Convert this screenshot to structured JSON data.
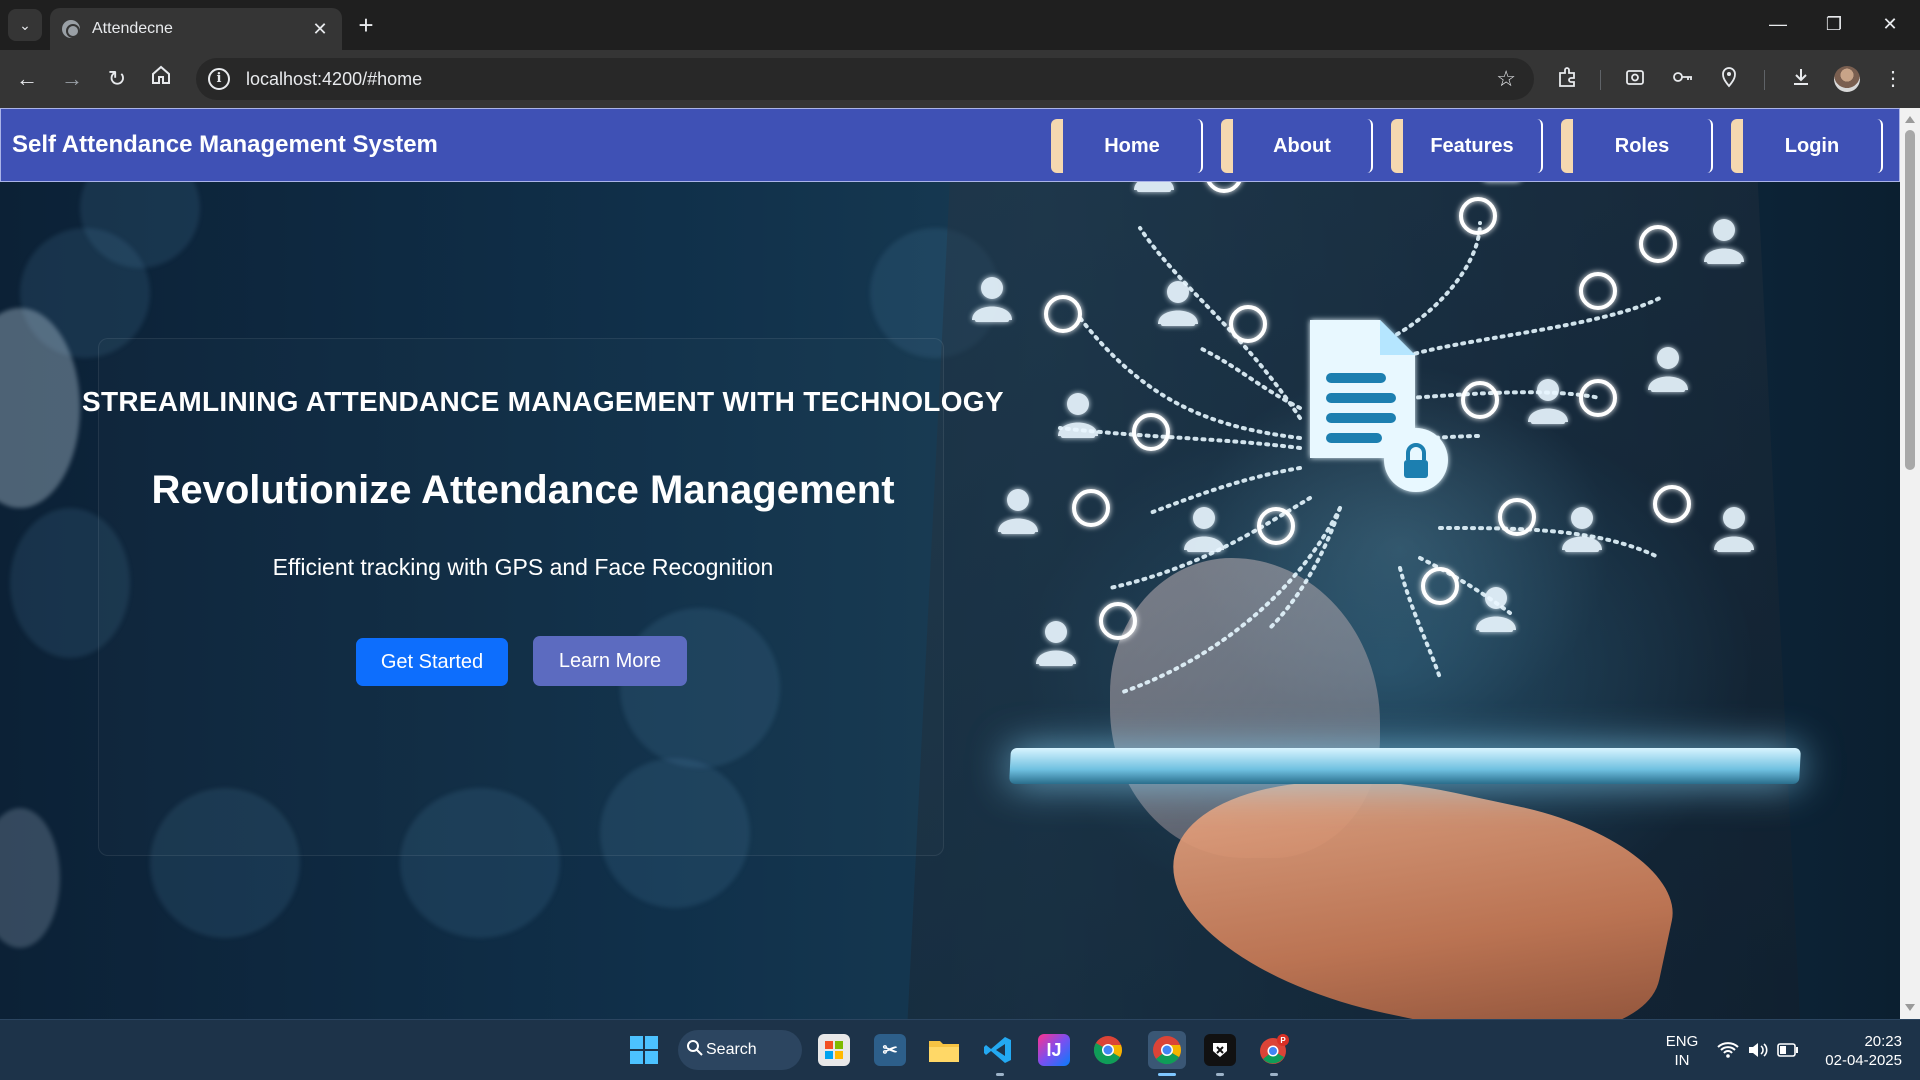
{
  "browser": {
    "tab_title": "Attendecne",
    "tab_close": "✕",
    "new_tab": "+",
    "url": "localhost:4200/#home",
    "window_controls": {
      "minimize": "—",
      "restore": "❐",
      "close": "✕"
    }
  },
  "navbar": {
    "brand": "Self Attendance Management System",
    "items": [
      {
        "label": "Home"
      },
      {
        "label": "About"
      },
      {
        "label": "Features"
      },
      {
        "label": "Roles"
      },
      {
        "label": "Login"
      }
    ],
    "accent_color": "#3f51b5"
  },
  "hero": {
    "tagline": "STREAMLINING ATTENDANCE MANAGEMENT WITH TECHNOLOGY",
    "headline": "Revolutionize Attendance Management",
    "subline": "Efficient tracking with GPS and Face Recognition",
    "primary_button": "Get Started",
    "secondary_button": "Learn More",
    "primary_color": "#0d6efd",
    "secondary_color": "#5c6bc0"
  },
  "taskbar": {
    "search_label": "Search",
    "language": "ENG",
    "region": "IN",
    "time": "20:23",
    "date": "02-04-2025",
    "apps": [
      "windows-start",
      "microsoft-store",
      "snipping-tool",
      "file-explorer",
      "vscode",
      "intellij",
      "chrome",
      "chrome-active",
      "app-black",
      "chrome-profile"
    ]
  }
}
